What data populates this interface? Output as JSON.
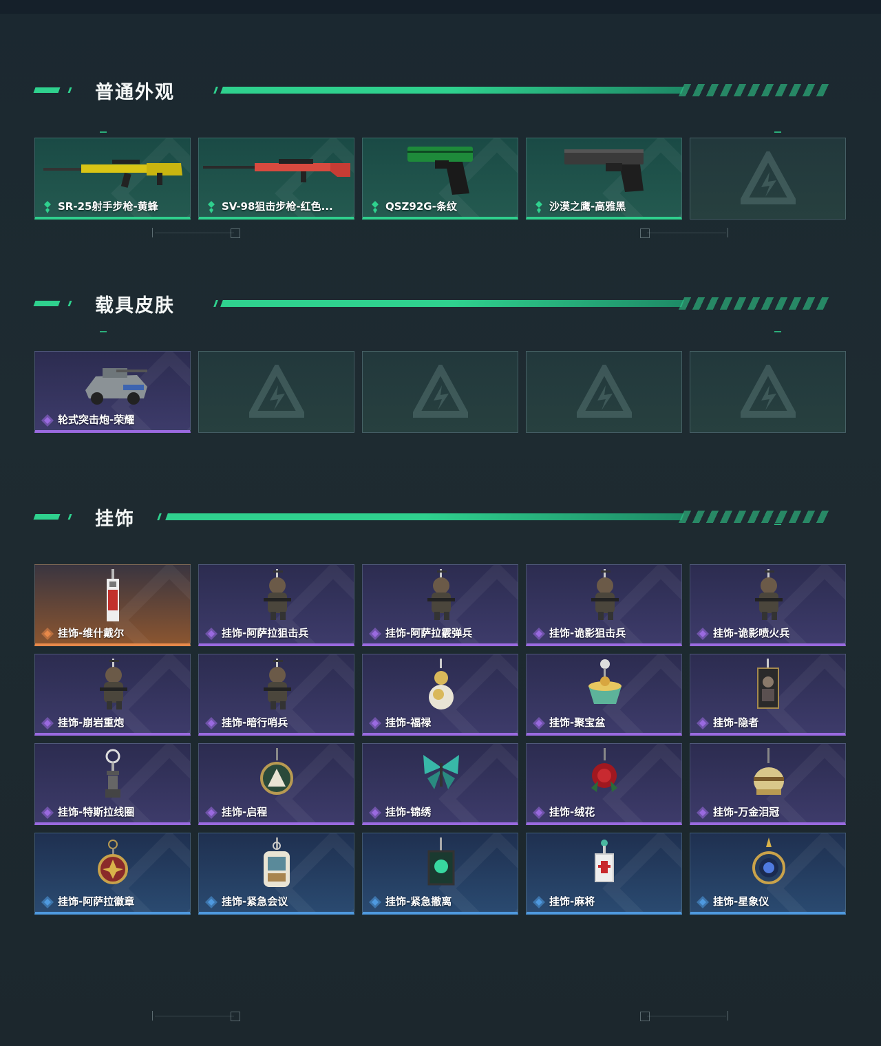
{
  "sections": [
    {
      "title": "普通外观",
      "items": [
        {
          "label": "SR-25射手步枪-黄蜂",
          "rarity": "green",
          "icon": "rifle-yellow-icon"
        },
        {
          "label": "SV-98狙击步枪-红色...",
          "rarity": "green",
          "icon": "sniper-red-icon"
        },
        {
          "label": "QSZ92G-条纹",
          "rarity": "green",
          "icon": "pistol-green-icon"
        },
        {
          "label": "沙漠之鹰-高雅黑",
          "rarity": "green",
          "icon": "pistol-black-icon"
        },
        {
          "label": "",
          "rarity": "empty",
          "icon": "empty-slot-logo-icon"
        }
      ]
    },
    {
      "title": "载具皮肤",
      "items": [
        {
          "label": "轮式突击炮-荣耀",
          "rarity": "purple",
          "icon": "vehicle-icon"
        },
        {
          "label": "",
          "rarity": "empty",
          "icon": "empty-slot-logo-icon"
        },
        {
          "label": "",
          "rarity": "empty",
          "icon": "empty-slot-logo-icon"
        },
        {
          "label": "",
          "rarity": "empty",
          "icon": "empty-slot-logo-icon"
        },
        {
          "label": "",
          "rarity": "empty",
          "icon": "empty-slot-logo-icon"
        }
      ]
    },
    {
      "title": "挂饰",
      "items": [
        {
          "label": "挂饰-维什戴尔",
          "rarity": "orange",
          "icon": "charm-card-icon"
        },
        {
          "label": "挂饰-阿萨拉狙击兵",
          "rarity": "purple",
          "icon": "charm-soldier-icon"
        },
        {
          "label": "挂饰-阿萨拉霰弹兵",
          "rarity": "purple",
          "icon": "charm-soldier-icon"
        },
        {
          "label": "挂饰-诡影狙击兵",
          "rarity": "purple",
          "icon": "charm-soldier-icon"
        },
        {
          "label": "挂饰-诡影喷火兵",
          "rarity": "purple",
          "icon": "charm-soldier-icon"
        },
        {
          "label": "挂饰-崩岩重炮",
          "rarity": "purple",
          "icon": "charm-soldier-icon"
        },
        {
          "label": "挂饰-暗行哨兵",
          "rarity": "purple",
          "icon": "charm-soldier-icon"
        },
        {
          "label": "挂饰-福禄",
          "rarity": "purple",
          "icon": "charm-gourd-icon"
        },
        {
          "label": "挂饰-聚宝盆",
          "rarity": "purple",
          "icon": "charm-bowl-icon"
        },
        {
          "label": "挂饰-隐者",
          "rarity": "purple",
          "icon": "charm-tarot-icon"
        },
        {
          "label": "挂饰-特斯拉线圈",
          "rarity": "purple",
          "icon": "charm-coil-icon"
        },
        {
          "label": "挂饰-启程",
          "rarity": "purple",
          "icon": "charm-medal-icon"
        },
        {
          "label": "挂饰-锦绣",
          "rarity": "purple",
          "icon": "charm-butterfly-icon"
        },
        {
          "label": "挂饰-绒花",
          "rarity": "purple",
          "icon": "charm-rose-icon"
        },
        {
          "label": "挂饰-万金泪冠",
          "rarity": "purple",
          "icon": "charm-crown-icon"
        },
        {
          "label": "挂饰-阿萨拉徽章",
          "rarity": "blue",
          "icon": "charm-badge-icon"
        },
        {
          "label": "挂饰-紧急会议",
          "rarity": "blue",
          "icon": "charm-sticker-icon"
        },
        {
          "label": "挂饰-紧急撤离",
          "rarity": "blue",
          "icon": "charm-cube-icon"
        },
        {
          "label": "挂饰-麻将",
          "rarity": "blue",
          "icon": "charm-mahjong-icon"
        },
        {
          "label": "挂饰-星象仪",
          "rarity": "blue",
          "icon": "charm-astrolabe-icon"
        }
      ]
    }
  ],
  "colors": {
    "accent_green": "#2fd18e",
    "rarity_green": "#2fd18e",
    "rarity_purple": "#9a6ae0",
    "rarity_orange": "#e7894a",
    "rarity_blue": "#4f9ae0"
  }
}
